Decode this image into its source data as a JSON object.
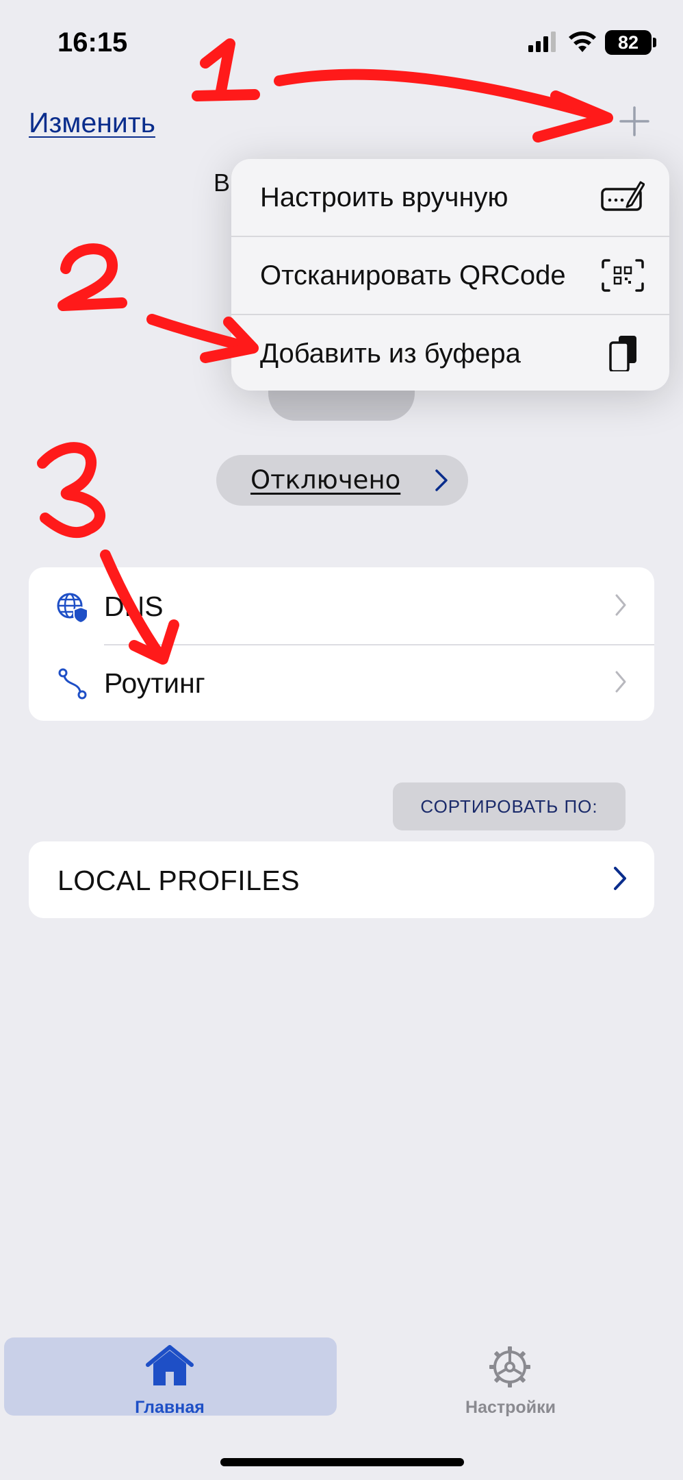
{
  "status_bar": {
    "time": "16:15",
    "battery": "82"
  },
  "header": {
    "edit_label": "Изменить",
    "hidden_text": "В"
  },
  "menu": {
    "items": [
      {
        "label": "Настроить вручную",
        "icon": "manual-edit-icon"
      },
      {
        "label": "Отсканировать QRCode",
        "icon": "qrcode-scan-icon"
      },
      {
        "label": "Добавить из буфера",
        "icon": "clipboard-icon"
      }
    ]
  },
  "connection": {
    "status": "Отключено"
  },
  "settings": {
    "rows": [
      {
        "label": "DNS",
        "icon": "globe-shield-icon"
      },
      {
        "label": "Роутинг",
        "icon": "route-icon"
      }
    ]
  },
  "sort": {
    "label": "СОРТИРОВАТЬ ПО:"
  },
  "profiles": {
    "label": "LOCAL PROFILES"
  },
  "tabs": [
    {
      "label": "Главная",
      "icon": "home-icon",
      "active": true
    },
    {
      "label": "Настройки",
      "icon": "gear-icon",
      "active": false
    }
  ],
  "annotations": {
    "marks": [
      "1",
      "2",
      "3"
    ],
    "color": "#ff1a1a"
  },
  "colors": {
    "accent": "#1e4fc6",
    "link": "#0a2d8c",
    "background": "#ececf1"
  }
}
